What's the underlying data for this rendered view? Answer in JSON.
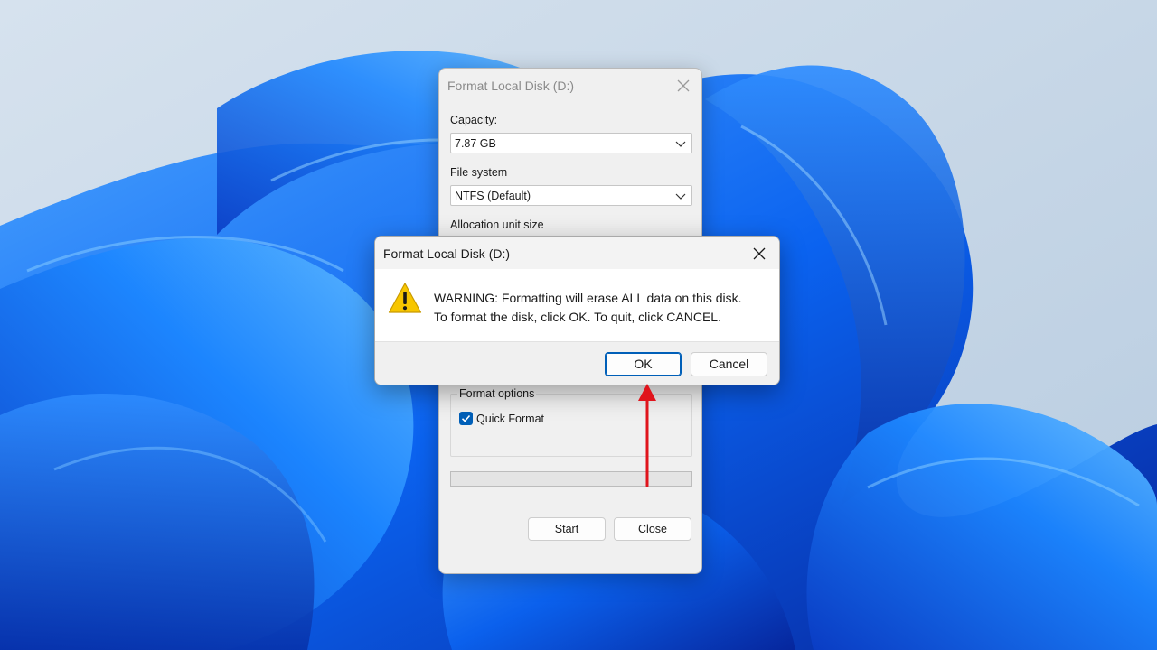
{
  "colors": {
    "accent": "#005fb8",
    "annotation_arrow": "#e0141c",
    "warning_icon": "#f7c600"
  },
  "background_window": {
    "title": "Format Local Disk (D:)",
    "capacity": {
      "label": "Capacity:",
      "value": "7.87 GB"
    },
    "file_system": {
      "label": "File system",
      "value": "NTFS (Default)"
    },
    "allocation_unit_size": {
      "label": "Allocation unit size"
    },
    "format_options": {
      "title": "Format options",
      "quick_format": {
        "label": "Quick Format",
        "checked": true
      }
    },
    "progress": 0,
    "start_label": "Start",
    "close_label": "Close"
  },
  "warning_dialog": {
    "title": "Format Local Disk (D:)",
    "message_line1": "WARNING: Formatting will erase ALL data on this disk.",
    "message_line2": "To format the disk, click OK. To quit, click CANCEL.",
    "ok_label": "OK",
    "cancel_label": "Cancel",
    "icon": "warning-icon"
  },
  "annotation": {
    "icon": "red-arrow-pointing-up",
    "target": "OK"
  }
}
